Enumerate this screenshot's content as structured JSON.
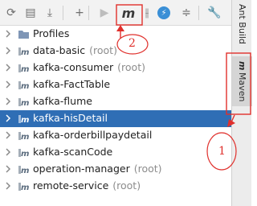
{
  "toolbar": {
    "buttons": [
      {
        "name": "reimport-icon",
        "glyph": "⟳",
        "dim": false
      },
      {
        "name": "add-project-icon",
        "glyph": "▤",
        "dim": false
      },
      {
        "name": "download-icon",
        "glyph": "⤓",
        "dim": false
      },
      {
        "name": "add-icon",
        "glyph": "+",
        "dim": false
      },
      {
        "name": "run-icon",
        "glyph": "▶",
        "dim": true
      },
      {
        "name": "execute-goal-icon",
        "glyph": "m",
        "dim": false
      },
      {
        "name": "toggle-offline-icon",
        "glyph": "⫲",
        "dim": false
      },
      {
        "name": "skip-tests-icon",
        "glyph": "⚡",
        "dim": false
      },
      {
        "name": "collapse-all-icon",
        "glyph": "≑",
        "dim": false
      },
      {
        "name": "settings-wrench-icon",
        "glyph": "🔧",
        "dim": false
      }
    ]
  },
  "tree": {
    "items": [
      {
        "label": "Profiles",
        "suffix": "",
        "icon": "folder-icon",
        "selected": false
      },
      {
        "label": "data-basic",
        "suffix": "(root)",
        "icon": "maven-module-icon",
        "selected": false
      },
      {
        "label": "kafka-consumer",
        "suffix": "(root)",
        "icon": "maven-module-icon",
        "selected": false
      },
      {
        "label": "kafka-FactTable",
        "suffix": "",
        "icon": "maven-module-icon",
        "selected": false
      },
      {
        "label": "kafka-flume",
        "suffix": "",
        "icon": "maven-module-icon",
        "selected": false
      },
      {
        "label": "kafka-hisDetail",
        "suffix": "",
        "icon": "maven-module-icon",
        "selected": true
      },
      {
        "label": "kafka-orderbillpaydetail",
        "suffix": "",
        "icon": "maven-module-icon",
        "selected": false
      },
      {
        "label": "kafka-scanCode",
        "suffix": "",
        "icon": "maven-module-icon",
        "selected": false
      },
      {
        "label": "operation-manager",
        "suffix": "(root)",
        "icon": "maven-module-icon",
        "selected": false
      },
      {
        "label": "remote-service",
        "suffix": "(root)",
        "icon": "maven-module-icon",
        "selected": false
      }
    ]
  },
  "side_tabs": {
    "ant_build": "Ant Build",
    "maven": "Maven"
  },
  "annotations": {
    "marker_1": "1",
    "marker_2": "2"
  },
  "colors": {
    "selection": "#2f6eb5",
    "annotation": "#e0302c",
    "folder": "#7f96b6"
  }
}
